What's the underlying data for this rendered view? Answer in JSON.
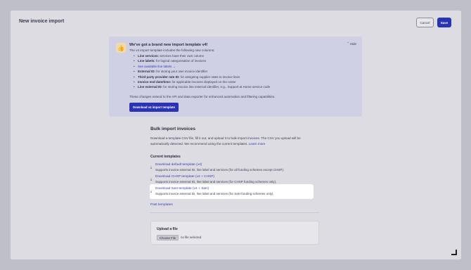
{
  "header": {
    "title": "New invoice import",
    "cancel_label": "Cancel",
    "save_label": "Save"
  },
  "notice": {
    "icon": "thumbs-up-icon",
    "title": "We've got a brand new import template v4!",
    "intro": "The v4 import template includes the following new columns:",
    "hide_label": "Hide",
    "features": [
      {
        "name": "Line services:",
        "text": " services have their own column",
        "link": ""
      },
      {
        "name": "Line labels:",
        "text": " for logical categorisation of invoices",
        "link": ""
      },
      {
        "name": "",
        "text": "",
        "link": "See available line labels →"
      },
      {
        "name": "External ID:",
        "text": " for storing your own invoice identifier",
        "link": ""
      },
      {
        "name": "Third party provider rate ID:",
        "text": " for assigning supplier rates to invoice lines",
        "link": ""
      },
      {
        "name": "Invoice end date/time:",
        "text": " for applicable invoices displayed on the roster",
        "link": ""
      },
      {
        "name": "Line external ID:",
        "text": " for storing invoice line external identifier, e.g., Support at Home service code",
        "link": ""
      }
    ],
    "footnote": "These changes extend to the API and data exporter for enhanced automation and filtering capabilities.",
    "download_button": "Download v4 import template"
  },
  "bulk": {
    "title": "Bulk import invoices",
    "description": "Download a template CSV file, fill it out, and upload it to bulk import invoices. The CSV you upload will be automatically detected. We recommend using the current templates.",
    "learn_more": "Learn more",
    "current_templates_label": "Current templates",
    "templates": [
      {
        "link": "Download default template (v4)",
        "description": "Supports invoice external ID, line label and services (for all funding schemes except CHSP)."
      },
      {
        "link": "Download CHSP template (v4 + CHSP)",
        "description": "Supports invoice external ID, line label and services (for CHSP funding schemes only)."
      },
      {
        "link": "Download SaH template (v4 + SaH)",
        "description": "Supports invoice external ID, line label and services (for SaH funding schemes only)."
      }
    ],
    "past_templates": "Past templates"
  },
  "upload": {
    "title": "Upload a file",
    "choose_file": "Choose File",
    "no_file": "no file selected"
  }
}
